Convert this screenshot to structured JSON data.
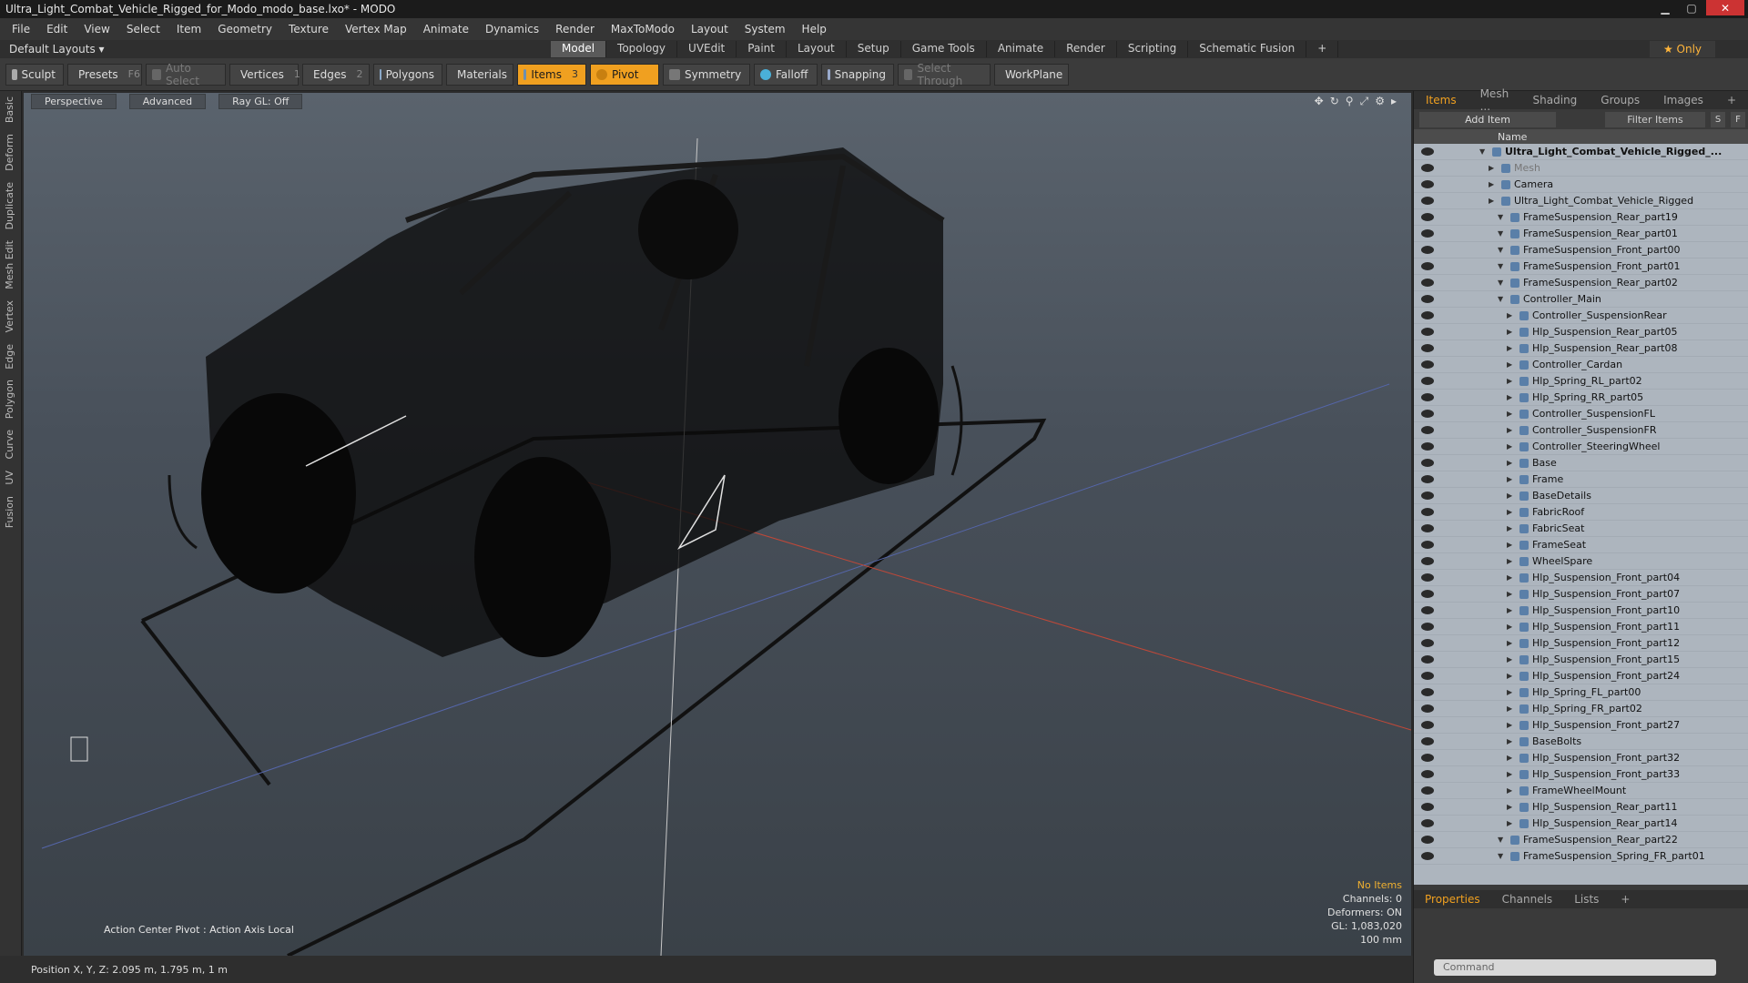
{
  "window": {
    "title": "Ultra_Light_Combat_Vehicle_Rigged_for_Modo_modo_base.lxo* - MODO"
  },
  "menu": [
    "File",
    "Edit",
    "View",
    "Select",
    "Item",
    "Geometry",
    "Texture",
    "Vertex Map",
    "Animate",
    "Dynamics",
    "Render",
    "MaxToModo",
    "Layout",
    "System",
    "Help"
  ],
  "layout": {
    "name": "Default Layouts ▾",
    "tabs": [
      "Model",
      "Topology",
      "UVEdit",
      "Paint",
      "Layout",
      "Setup",
      "Game Tools",
      "Animate",
      "Render",
      "Scripting",
      "Schematic Fusion",
      "+"
    ],
    "active_tab": "Model",
    "only_label": "★ Only"
  },
  "toolbar": {
    "sculpt": "Sculpt",
    "presets": "Presets",
    "presets_key": "F6",
    "auto_select": "Auto Select",
    "vertices": "Vertices",
    "vertices_count": "1",
    "edges": "Edges",
    "edges_count": "2",
    "polygons": "Polygons",
    "materials": "Materials",
    "items": "Items",
    "items_count": "3",
    "pivot": "Pivot",
    "symmetry": "Symmetry",
    "falloff": "Falloff",
    "snapping": "Snapping",
    "select_through": "Select Through",
    "workplane": "WorkPlane"
  },
  "left_tabs": [
    "Basic",
    "Deform",
    "Duplicate",
    "Mesh Edit",
    "Vertex",
    "Edge",
    "Polygon",
    "Curve",
    "UV",
    "Fusion"
  ],
  "viewport": {
    "buttons": [
      "Perspective",
      "Advanced",
      "Ray GL: Off"
    ],
    "info": {
      "no_items": "No Items",
      "channels": "Channels: 0",
      "deformers": "Deformers: ON",
      "gl": "GL: 1,083,020",
      "scale": "100 mm"
    },
    "action_center": "Action Center Pivot : Action Axis Local"
  },
  "status": {
    "position": "Position X, Y, Z:   2.095 m, 1.795 m, 1 m"
  },
  "right_panel": {
    "tabs": [
      "Items",
      "Mesh ...",
      "Shading",
      "Groups",
      "Images",
      "+"
    ],
    "add_item": "Add Item",
    "filter": "Filter Items",
    "column": "Name",
    "tree": [
      {
        "label": "Ultra_Light_Combat_Vehicle_Rigged_...",
        "indent": 0,
        "bold": true
      },
      {
        "label": "Mesh",
        "indent": 1,
        "dim": true
      },
      {
        "label": "Camera",
        "indent": 1
      },
      {
        "label": "Ultra_Light_Combat_Vehicle_Rigged",
        "indent": 1
      },
      {
        "label": "FrameSuspension_Rear_part19",
        "indent": 2
      },
      {
        "label": "FrameSuspension_Rear_part01",
        "indent": 2
      },
      {
        "label": "FrameSuspension_Front_part00",
        "indent": 2
      },
      {
        "label": "FrameSuspension_Front_part01",
        "indent": 2
      },
      {
        "label": "FrameSuspension_Rear_part02",
        "indent": 2
      },
      {
        "label": "Controller_Main",
        "indent": 2
      },
      {
        "label": "Controller_SuspensionRear",
        "indent": 3
      },
      {
        "label": "Hlp_Suspension_Rear_part05",
        "indent": 3
      },
      {
        "label": "Hlp_Suspension_Rear_part08",
        "indent": 3
      },
      {
        "label": "Controller_Cardan",
        "indent": 3
      },
      {
        "label": "Hlp_Spring_RL_part02",
        "indent": 3
      },
      {
        "label": "Hlp_Spring_RR_part05",
        "indent": 3
      },
      {
        "label": "Controller_SuspensionFL",
        "indent": 3
      },
      {
        "label": "Controller_SuspensionFR",
        "indent": 3
      },
      {
        "label": "Controller_SteeringWheel",
        "indent": 3
      },
      {
        "label": "Base",
        "indent": 3
      },
      {
        "label": "Frame",
        "indent": 3
      },
      {
        "label": "BaseDetails",
        "indent": 3
      },
      {
        "label": "FabricRoof",
        "indent": 3
      },
      {
        "label": "FabricSeat",
        "indent": 3
      },
      {
        "label": "FrameSeat",
        "indent": 3
      },
      {
        "label": "WheelSpare",
        "indent": 3
      },
      {
        "label": "Hlp_Suspension_Front_part04",
        "indent": 3
      },
      {
        "label": "Hlp_Suspension_Front_part07",
        "indent": 3
      },
      {
        "label": "Hlp_Suspension_Front_part10",
        "indent": 3
      },
      {
        "label": "Hlp_Suspension_Front_part11",
        "indent": 3
      },
      {
        "label": "Hlp_Suspension_Front_part12",
        "indent": 3
      },
      {
        "label": "Hlp_Suspension_Front_part15",
        "indent": 3
      },
      {
        "label": "Hlp_Suspension_Front_part24",
        "indent": 3
      },
      {
        "label": "Hlp_Spring_FL_part00",
        "indent": 3
      },
      {
        "label": "Hlp_Spring_FR_part02",
        "indent": 3
      },
      {
        "label": "Hlp_Suspension_Front_part27",
        "indent": 3
      },
      {
        "label": "BaseBolts",
        "indent": 3
      },
      {
        "label": "Hlp_Suspension_Front_part32",
        "indent": 3
      },
      {
        "label": "Hlp_Suspension_Front_part33",
        "indent": 3
      },
      {
        "label": "FrameWheelMount",
        "indent": 3
      },
      {
        "label": "Hlp_Suspension_Rear_part11",
        "indent": 3
      },
      {
        "label": "Hlp_Suspension_Rear_part14",
        "indent": 3
      },
      {
        "label": "FrameSuspension_Rear_part22",
        "indent": 2
      },
      {
        "label": "FrameSuspension_Spring_FR_part01",
        "indent": 2
      }
    ]
  },
  "properties": {
    "tabs": [
      "Properties",
      "Channels",
      "Lists",
      "+"
    ],
    "command_placeholder": "Command"
  }
}
